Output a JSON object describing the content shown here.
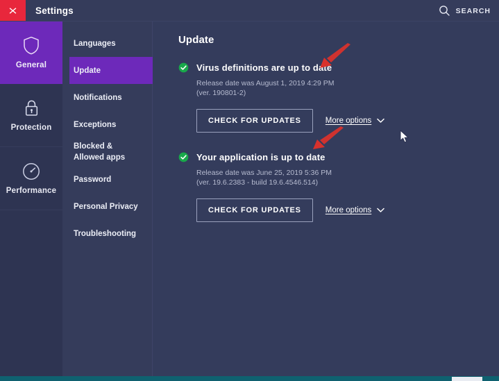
{
  "titlebar": {
    "close_icon": "close-icon",
    "title": "Settings",
    "search_icon": "search-icon",
    "search_label": "SEARCH"
  },
  "rail": {
    "items": [
      {
        "label": "General",
        "icon": "shield-icon",
        "active": true
      },
      {
        "label": "Protection",
        "icon": "lock-icon",
        "active": false
      },
      {
        "label": "Performance",
        "icon": "speedometer-icon",
        "active": false
      }
    ]
  },
  "subnav": {
    "items": [
      {
        "label": "Languages",
        "active": false
      },
      {
        "label": "Update",
        "active": true
      },
      {
        "label": "Notifications",
        "active": false
      },
      {
        "label": "Exceptions",
        "active": false
      },
      {
        "label": "Blocked & Allowed apps",
        "active": false
      },
      {
        "label": "Password",
        "active": false
      },
      {
        "label": "Personal Privacy",
        "active": false
      },
      {
        "label": "Troubleshooting",
        "active": false
      }
    ]
  },
  "main": {
    "page_title": "Update",
    "blocks": [
      {
        "status_icon": "green-check-icon",
        "title": "Virus definitions are up to date",
        "release_line1": "Release date was August 1, 2019 4:29 PM",
        "release_line2": "(ver. 190801-2)",
        "button_label": "CHECK FOR UPDATES",
        "more_options_label": "More options",
        "more_options_icon": "chevron-down-icon"
      },
      {
        "status_icon": "green-check-icon",
        "title": "Your application is up to date",
        "release_line1": "Release date was June 25, 2019 5:36 PM",
        "release_line2": "(ver. 19.6.2383 - build 19.6.4546.514)",
        "button_label": "CHECK FOR UPDATES",
        "more_options_label": "More options",
        "more_options_icon": "chevron-down-icon"
      }
    ]
  },
  "annotations": [
    {
      "name": "red-arrow-icon",
      "points_to": "Virus definitions are up to date"
    },
    {
      "name": "red-arrow-icon",
      "points_to": "Your application is up to date"
    }
  ],
  "cursor": {
    "icon": "mouse-pointer-icon"
  },
  "colors": {
    "accent_purple": "#6d29ba",
    "close_red": "#e8273c",
    "status_green": "#1aa84a",
    "arrow_red": "#d8312c",
    "panel_bg": "#343c5c",
    "rail_bg": "#2e3452",
    "bottom_strip": "#0f6170"
  }
}
